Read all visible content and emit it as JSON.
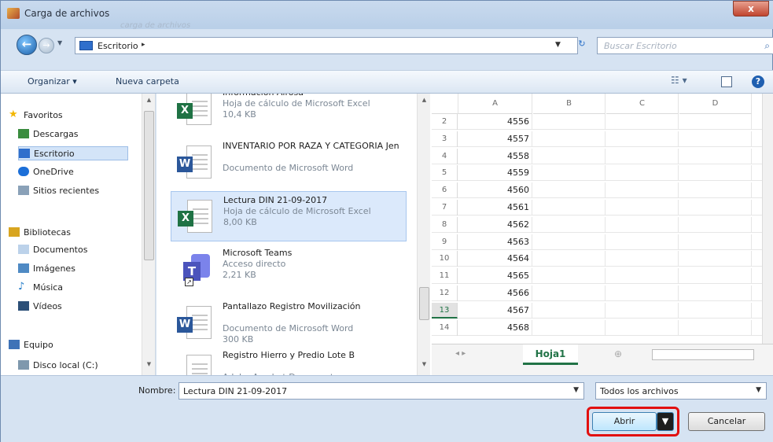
{
  "window": {
    "title": "Carga de archivos",
    "title_ghost": "carga de archivos",
    "close_label": "x"
  },
  "nav": {
    "back_glyph": "←",
    "forward_glyph": "→",
    "address_location": "Escritorio",
    "address_separator": "▸",
    "refresh_glyph": "↻",
    "search_placeholder": "Buscar Escritorio",
    "search_icon": "search-icon"
  },
  "toolbar": {
    "organize": "Organizar ▾",
    "new_folder": "Nueva carpeta",
    "help": "?"
  },
  "sidebar": {
    "items": [
      {
        "label": "Favoritos",
        "icon": "star-icon",
        "color": "#f2b600",
        "type": "group"
      },
      {
        "label": "Descargas",
        "icon": "downloads-folder-icon",
        "color": "#3a8c3e",
        "type": "child"
      },
      {
        "label": "Escritorio",
        "icon": "desktop-icon",
        "color": "#2f6fcc",
        "type": "child",
        "selected": true
      },
      {
        "label": "OneDrive",
        "icon": "cloud-icon",
        "color": "#1c6fd8",
        "type": "child"
      },
      {
        "label": "Sitios recientes",
        "icon": "recent-places-icon",
        "color": "#8aa1b8",
        "type": "child"
      },
      {
        "label": "Bibliotecas",
        "icon": "libraries-icon",
        "color": "#d8a520",
        "type": "group"
      },
      {
        "label": "Documentos",
        "icon": "documents-icon",
        "color": "#bcd2ea",
        "type": "child"
      },
      {
        "label": "Imágenes",
        "icon": "pictures-icon",
        "color": "#4f8ac4",
        "type": "child"
      },
      {
        "label": "Música",
        "icon": "music-icon",
        "color": "#1d78c8",
        "type": "child"
      },
      {
        "label": "Vídeos",
        "icon": "videos-icon",
        "color": "#2c4f77",
        "type": "child"
      },
      {
        "label": "Equipo",
        "icon": "computer-icon",
        "color": "#3f73b7",
        "type": "group"
      },
      {
        "label": "Disco local (C:)",
        "icon": "drive-icon",
        "color": "#7f98ad",
        "type": "child"
      }
    ]
  },
  "files": [
    {
      "name": "Informacion Airosa",
      "type": "Hoja de cálculo de Microsoft Excel",
      "size": "10,4 KB",
      "kind": "xls",
      "badge": "X"
    },
    {
      "name": "INVENTARIO POR RAZA Y CATEGORIA Jen",
      "type": "Documento de Microsoft Word",
      "size": "",
      "kind": "doc",
      "badge": "W"
    },
    {
      "name": "Lectura DIN 21-09-2017",
      "type": "Hoja de cálculo de Microsoft Excel",
      "size": "8,00 KB",
      "kind": "xls",
      "badge": "X",
      "selected": true
    },
    {
      "name": "Microsoft Teams",
      "type": "Acceso directo",
      "size": "2,21 KB",
      "kind": "teams",
      "badge": "T"
    },
    {
      "name": "Pantallazo Registro Movilización",
      "type": "Documento de Microsoft Word",
      "size": "300 KB",
      "kind": "doc",
      "badge": "W"
    },
    {
      "name": "Registro Hierro y Predio Lote B",
      "type": "Adobe Acrobat Document",
      "size": "",
      "kind": "pdf",
      "badge": ""
    }
  ],
  "preview": {
    "columns": [
      "A",
      "B",
      "C",
      "D"
    ],
    "rows": [
      {
        "num": "2",
        "value": "4556"
      },
      {
        "num": "3",
        "value": "4557"
      },
      {
        "num": "4",
        "value": "4558"
      },
      {
        "num": "5",
        "value": "4559"
      },
      {
        "num": "6",
        "value": "4560"
      },
      {
        "num": "7",
        "value": "4561"
      },
      {
        "num": "8",
        "value": "4562"
      },
      {
        "num": "9",
        "value": "4563"
      },
      {
        "num": "10",
        "value": "4564"
      },
      {
        "num": "11",
        "value": "4565"
      },
      {
        "num": "12",
        "value": "4566"
      },
      {
        "num": "13",
        "value": "4567",
        "selected": true
      },
      {
        "num": "14",
        "value": "4568"
      }
    ],
    "sheet_tab": "Hoja1",
    "excel_green": "#217346"
  },
  "footer": {
    "filename_label": "Nombre:",
    "filename_value": "Lectura DIN 21-09-2017",
    "filetype_value": "Todos los archivos",
    "open_label": "Abrir",
    "cancel_label": "Cancelar",
    "highlight_color": "#e21010"
  }
}
